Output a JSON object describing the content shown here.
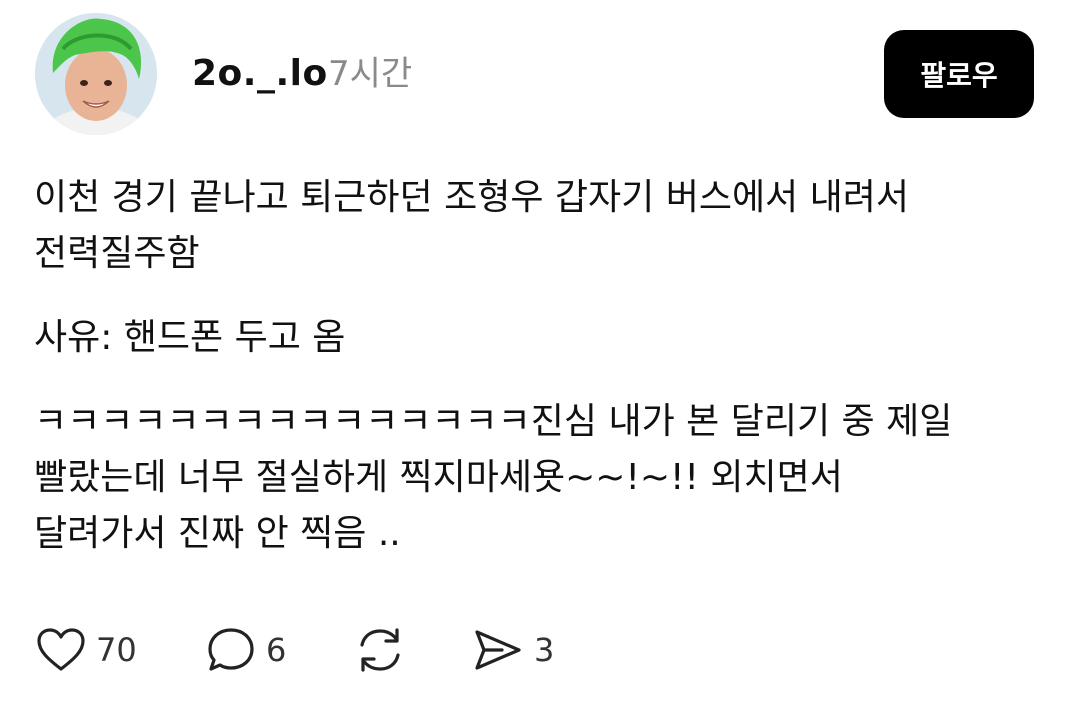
{
  "post": {
    "username": "2o._.lo",
    "time_ago": "7시간",
    "follow_label": "팔로우",
    "paragraphs": [
      {
        "lines": [
          "이천 경기 끝나고 퇴근하던 조형우 갑자기 버스에서 내려서",
          "전력질주함"
        ]
      },
      {
        "lines": [
          "사유: 핸드폰 두고 옴"
        ]
      },
      {
        "lines": [
          "ㅋㅋㅋㅋㅋㅋㅋㅋㅋㅋㅋㅋㅋㅋㅋ진심 내가 본 달리기 중 제일",
          "빨랐는데 너무 절실하게 찍지마세욧~~!~!! 외치면서",
          "달려가서 진짜 안 찍음 .."
        ]
      }
    ],
    "actions": {
      "like_count": "70",
      "comment_count": "6",
      "share_count": "3",
      "icons": [
        "heart-icon",
        "comment-icon",
        "repost-icon",
        "send-icon"
      ]
    }
  }
}
